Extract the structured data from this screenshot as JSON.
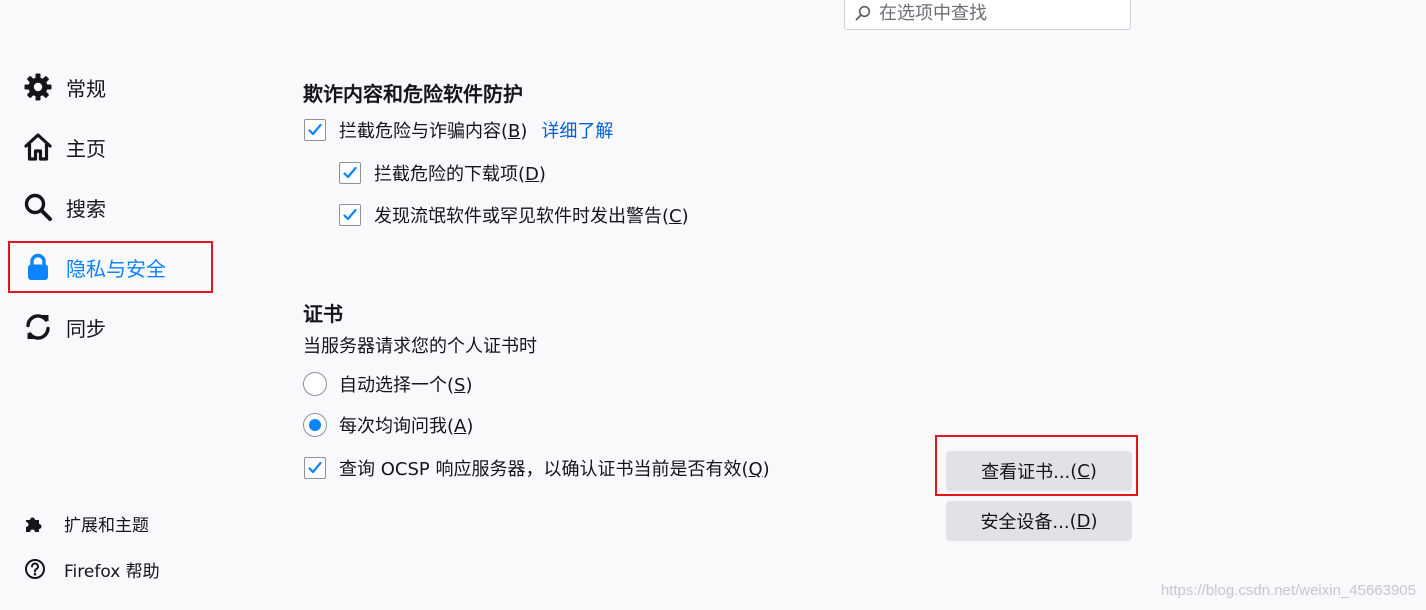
{
  "search": {
    "placeholder": "在选项中查找"
  },
  "sidebar": {
    "items": [
      {
        "label": "常规",
        "icon": "gear-icon"
      },
      {
        "label": "主页",
        "icon": "home-icon"
      },
      {
        "label": "搜索",
        "icon": "search-icon"
      },
      {
        "label": "隐私与安全",
        "icon": "lock-icon",
        "selected": true
      },
      {
        "label": "同步",
        "icon": "sync-icon"
      }
    ],
    "footer": [
      {
        "label": "扩展和主题",
        "icon": "puzzle-icon"
      },
      {
        "label": "Firefox 帮助",
        "icon": "help-icon"
      }
    ]
  },
  "fraud": {
    "title": "欺诈内容和危险软件防护",
    "block_dangerous": {
      "label": "拦截危险与诈骗内容",
      "key": "B",
      "checked": true
    },
    "learn_more": "详细了解",
    "block_downloads": {
      "label": "拦截危险的下载项",
      "key": "D",
      "checked": true
    },
    "warn_unwanted": {
      "label": "发现流氓软件或罕见软件时发出警告",
      "key": "C",
      "checked": true
    }
  },
  "certs": {
    "title": "证书",
    "subtitle": "当服务器请求您的个人证书时",
    "auto_select": {
      "label": "自动选择一个",
      "key": "S",
      "checked": false
    },
    "ask_every": {
      "label": "每次均询问我",
      "key": "A",
      "checked": true
    },
    "ocsp": {
      "label": "查询 OCSP 响应服务器，以确认证书当前是否有效",
      "key": "Q",
      "checked": true
    },
    "view_button": {
      "label": "查看证书...",
      "key": "C"
    },
    "devices_button": {
      "label": "安全设备...",
      "key": "D"
    }
  },
  "colors": {
    "accent": "#0a84ff",
    "link": "#0060df",
    "highlight": "#e3141b",
    "button_bg": "#e2e2e6"
  },
  "watermark": "https://blog.csdn.net/weixin_45663905"
}
